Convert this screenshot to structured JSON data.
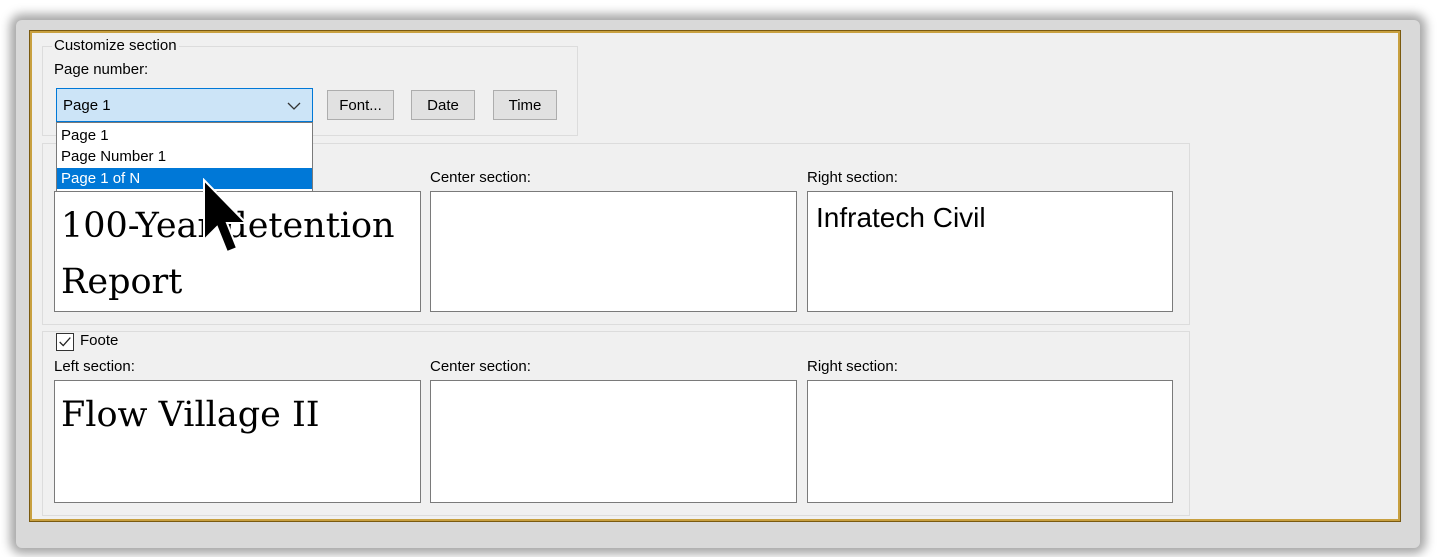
{
  "customize": {
    "title": "Customize section",
    "page_number_label": "Page number:",
    "page_number_value": "Page 1",
    "dropdown_options": [
      "Page 1",
      "Page Number 1",
      "Page 1 of N"
    ],
    "selected_option": "Page 1 of N",
    "font_button": "Font...",
    "date_button": "Date",
    "time_button": "Time"
  },
  "header": {
    "center_label": "Center section:",
    "right_label": "Right section:",
    "left_text": "100-Year detention\nReport",
    "center_text": "",
    "right_text": "Infratech Civil"
  },
  "footer": {
    "checkbox_label": "Foote",
    "checked": true,
    "left_label": "Left section:",
    "center_label": "Center section:",
    "right_label": "Right section:",
    "left_text": "Flow Village II",
    "center_text": "",
    "right_text": ""
  },
  "colors": {
    "accent": "#0078d7",
    "selected_row": "#0078d7",
    "combo_fill": "#cce4f7",
    "frame_border": "#c8a040"
  }
}
